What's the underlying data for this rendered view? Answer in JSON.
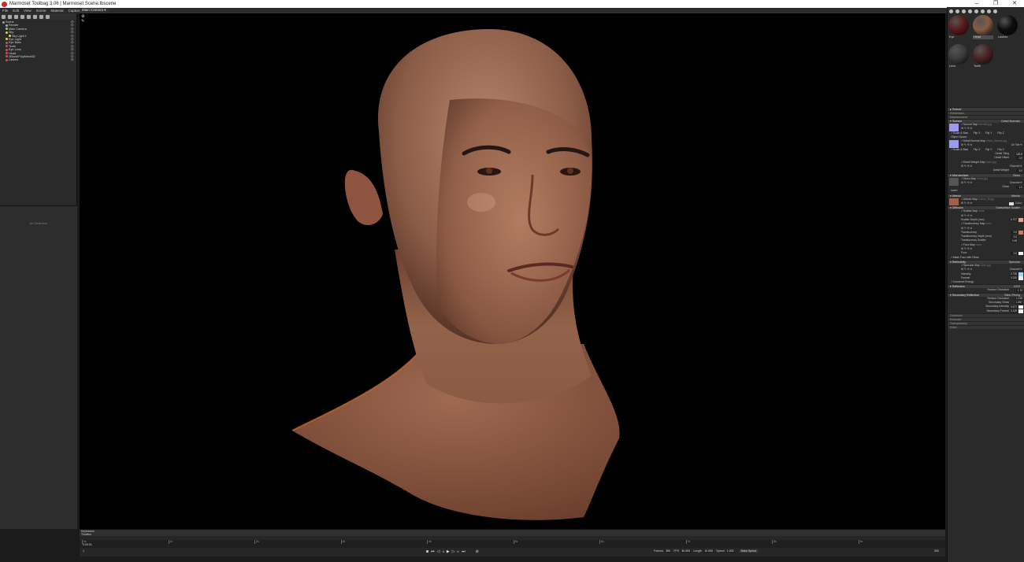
{
  "window": {
    "title": "Marmoset Toolbag 3.06  |  Marmoset Scene.tbscene",
    "controls": [
      "–",
      "❐",
      "✕"
    ]
  },
  "menu": [
    "File",
    "Edit",
    "View",
    "Scene",
    "Material",
    "Capture",
    "Help"
  ],
  "viewport_camera": "Main Camera ▾",
  "scene_tree": [
    {
      "label": "Scene",
      "indent": 0,
      "color": "#8aa0c0"
    },
    {
      "label": "Render",
      "indent": 1,
      "color": "#aaaaaa"
    },
    {
      "label": "Main Camera",
      "indent": 1,
      "color": "#9ccf6a"
    },
    {
      "label": "Sky",
      "indent": 1,
      "color": "#e0d060"
    },
    {
      "label": "Sky Light 1",
      "indent": 2,
      "color": "#e0d060"
    },
    {
      "label": "Eye Light",
      "indent": 1,
      "color": "#e0d060"
    },
    {
      "label": "Eye Balls",
      "indent": 1,
      "color": "#d05050"
    },
    {
      "label": "Teeth",
      "indent": 1,
      "color": "#d05050"
    },
    {
      "label": "Eye Lens",
      "indent": 1,
      "color": "#d05050"
    },
    {
      "label": "Head",
      "indent": 1,
      "color": "#d05050"
    },
    {
      "label": "ZBrushPolyMesh3D",
      "indent": 1,
      "color": "#d05050"
    },
    {
      "label": "Lashes",
      "indent": 1,
      "color": "#d05050"
    }
  ],
  "no_selection": "No Selection",
  "materials": [
    {
      "name": "Eye",
      "color": "#5a1a1a",
      "selected": false
    },
    {
      "name": "Head",
      "color": "#8a5a44",
      "selected": true
    },
    {
      "name": "Lashes",
      "color": "#0d0d0d",
      "selected": false
    },
    {
      "name": "Lens",
      "color": "#3a3a3a",
      "selected": false
    },
    {
      "name": "Teeth",
      "color": "#4a2222",
      "selected": false
    }
  ],
  "properties": {
    "sections": {
      "texture": "Texture",
      "subdivision": "Subdivision",
      "displacement": "Displacement",
      "surface": "Surface",
      "surface_mode": "Detail Normals",
      "microsurface": "Microsurface",
      "microsurface_mode": "Gloss",
      "albedo": "Albedo",
      "albedo_mode": "Albedo",
      "diffusion": "Diffusion",
      "diffusion_mode": "Subsurface Scatter",
      "reflectivity": "Reflectivity",
      "reflectivity_mode": "Specular",
      "reflection": "Reflection",
      "reflection_mode": "GGX",
      "secondary_reflection": "Secondary Reflection",
      "secondary_reflection_mode": "Blinn-Phong",
      "occlusion": "Occlusion",
      "emissive": "Emissive",
      "transparency": "Transparency",
      "extra": "Extra"
    },
    "surface": {
      "normal_map": "✓Normal Map",
      "normal_map_file": "Normal.jpg",
      "scale_bias": "✓Scale & Bias",
      "flip_x": "Flip X",
      "flip_y": "Flip Y",
      "flip_z": "Flip Z",
      "object_space": "Object Space",
      "detail_normal_map": "✓Detail Normal Map",
      "detail_normal_file": "Micro_Normal.jpg",
      "uv_set": "UV Set ▾",
      "detail_tiling_label": "Detail Tiling",
      "detail_tiling": "183.8",
      "detail_offset_label": "Detail Offset",
      "detail_offset": "0.0",
      "detail_weight_map": "✓Detail Weight Map",
      "detail_weight_file": "Spec.jpg",
      "channel": "Channel ▾",
      "detail_weight_label": "Detail Weight",
      "detail_weight": "5.0"
    },
    "microsurface": {
      "gloss_map": "✓Gloss Map",
      "gloss_map_file": "Gloss.jpg",
      "channel": "Channel ▾",
      "gloss_label": "Gloss",
      "gloss": "1.0",
      "invert": "Invert"
    },
    "albedo": {
      "albedo_map": "✓Albedo Map",
      "albedo_map_file": "Colour_B.jpg",
      "color_label": "Color"
    },
    "diffusion": {
      "scatter_map": "✓Scatter Map",
      "scatter_map_file": "none",
      "scatter_depth_label": "Scatter Depth (mm)",
      "scatter_depth": "6.707",
      "translucency_map": "✓Translucency Map",
      "translucency_map_file": "none",
      "translucency_label": "Translucency",
      "translucency": "0.0",
      "translucency_depth_label": "Translucency Depth (mm)",
      "translucency_depth": "0.0",
      "translucency_scatter_label": "Translucency Scatter",
      "translucency_scatter": "0.45",
      "fuzz_map": "✓Fuzz Map",
      "fuzz_map_file": "none",
      "fuzz_label": "Fuzz",
      "fuzz": "0.0",
      "mask_fuzz": "✓Mask Fuzz with Gloss"
    },
    "reflectivity": {
      "specular_map": "✓Specular Map",
      "specular_map_file": "Spec.jpg",
      "channel": "Channel ▾",
      "intensity_label": "Intensity",
      "intensity": "0.735",
      "fresnel_label": "Fresnel",
      "fresnel": "0.220",
      "conserve_energy": "✓Conserve Energy"
    },
    "reflection": {
      "horizon_occlusion_label": "Horizon Occlusion",
      "horizon_occlusion": "1.70"
    },
    "secondary_reflection": {
      "horizon_occlusion_label": "Horizon Occlusion",
      "horizon_occlusion": "1.128",
      "secondary_gloss_label": "Secondary Gloss",
      "secondary_gloss": "1.557",
      "secondary_intensity_label": "Secondary Intensity",
      "secondary_intensity": "0.677",
      "secondary_fresnel_label": "Secondary Fresnel",
      "secondary_fresnel": "0.125"
    },
    "colors": {
      "normal_thumb": "#9a9af0",
      "albedo_thumb": "#a0604a",
      "scatter_swatch": "#e8a080",
      "translucency_swatch": "#e07050",
      "fuzz_swatch": "#f0f0f0",
      "intensity_swatch": "#a0d8f0",
      "fresnel_swatch": "#e0f0ff",
      "white_swatch": "#ffffff"
    }
  },
  "timeline": {
    "keyframes": "Keyframes",
    "timeline": "Timeline",
    "current": "0:00.01",
    "frame_field": "1",
    "ticks": [
      "0s",
      "1s",
      "2s",
      "3s",
      "4s",
      "5s",
      "6s",
      "7s",
      "8s",
      "9s"
    ],
    "frames_label": "Frames",
    "frames": "300",
    "fps_label": "FPS",
    "fps": "30.000",
    "length_label": "Length",
    "length": "10.000",
    "speed_label": "Speed",
    "speed": "1.000",
    "bake_speed": "Bake Speed",
    "end_field": "300"
  }
}
